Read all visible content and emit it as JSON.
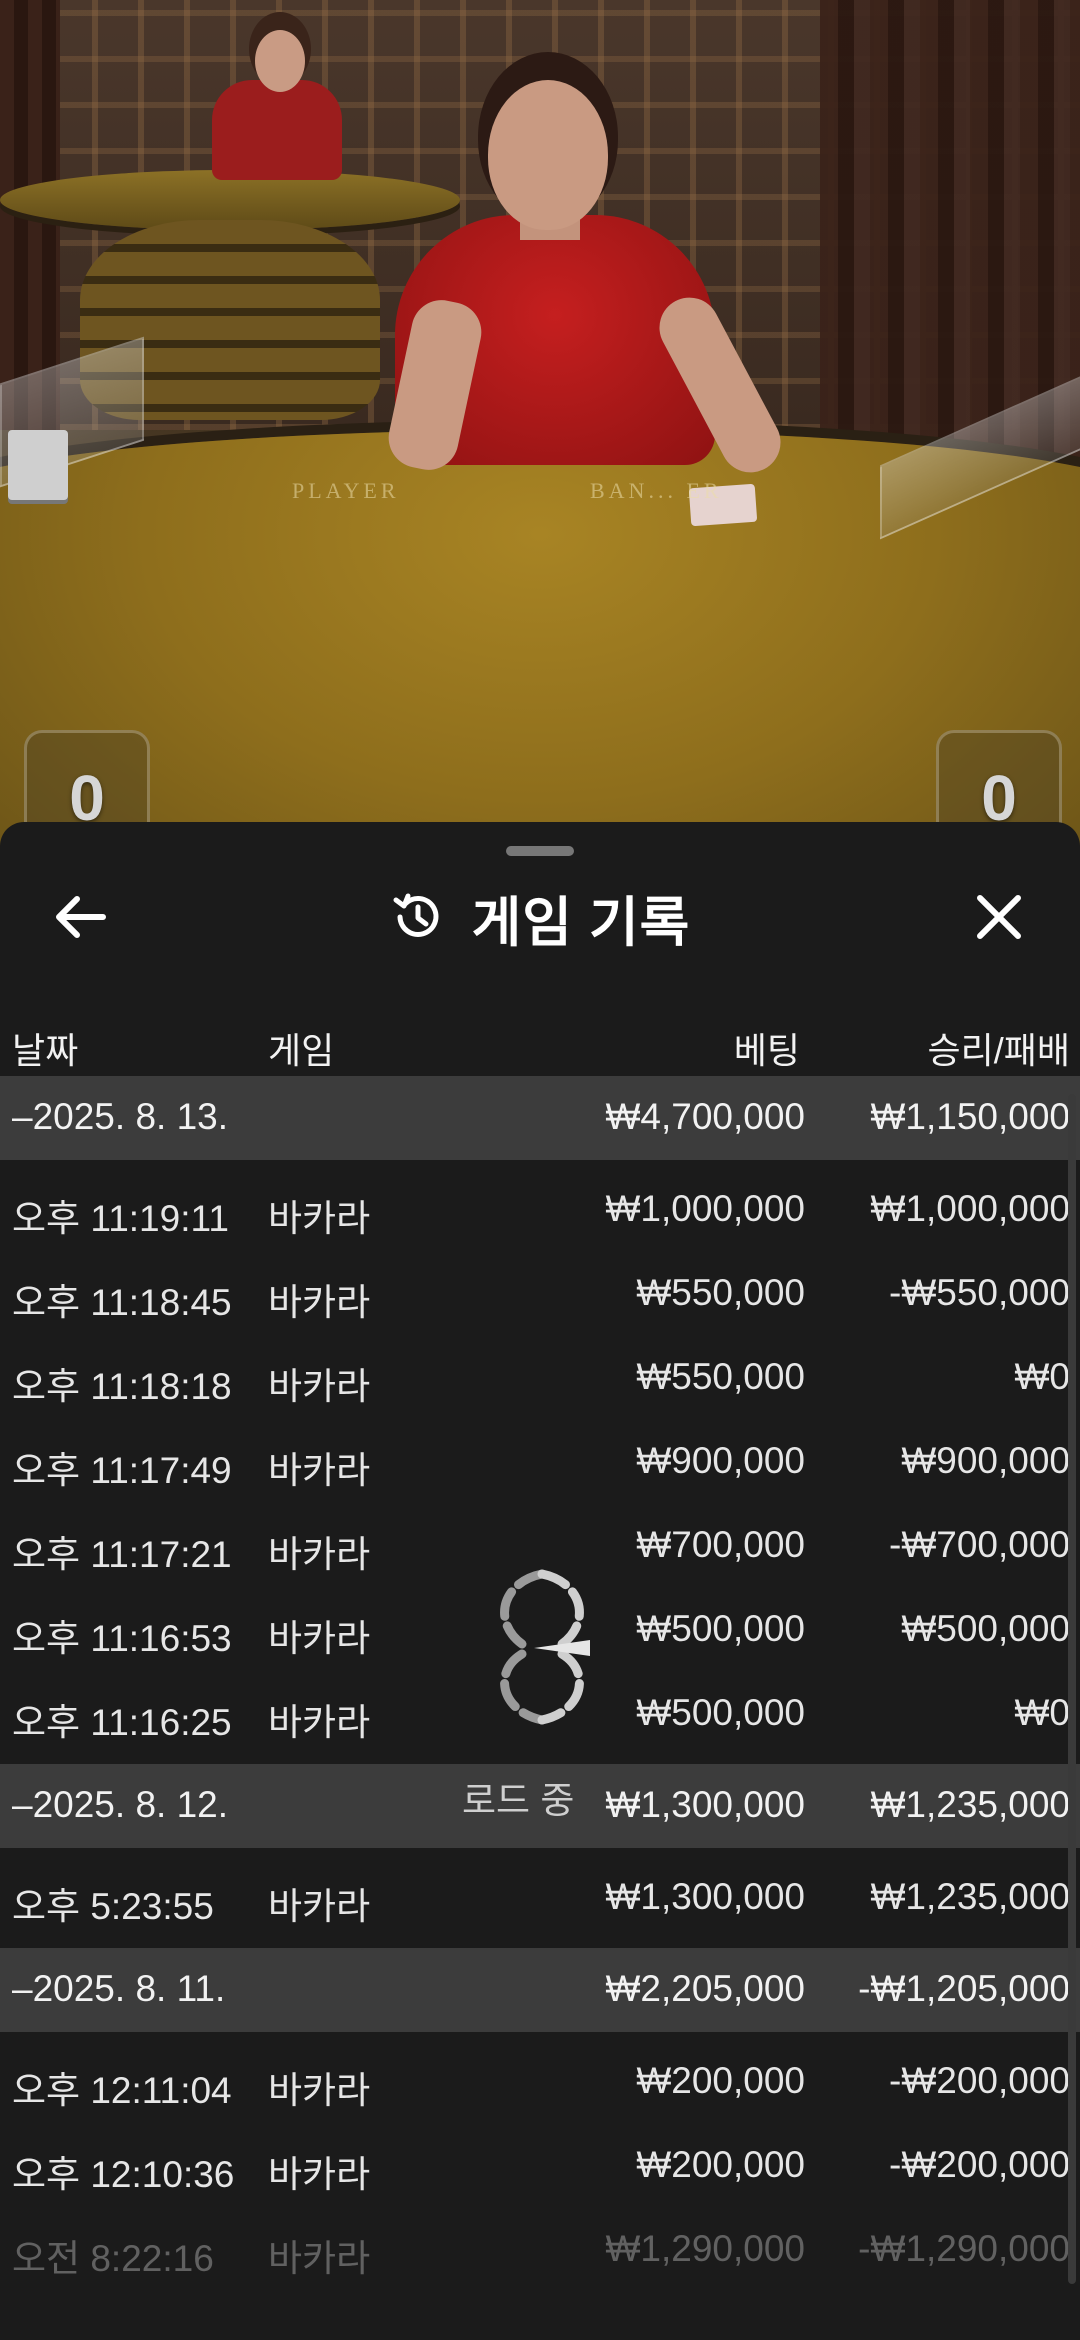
{
  "sheet": {
    "title": "게임 기록",
    "headers": {
      "date": "날짜",
      "game": "게임",
      "bet": "베팅",
      "win_loss": "승리/패배"
    },
    "loading_text": "로드 중"
  },
  "video": {
    "score_player": "0",
    "score_banker": "0",
    "table_labels": {
      "player": "PLAYER",
      "banker": "BAN... ER"
    }
  },
  "groups": [
    {
      "date": "–2025. 8. 13.",
      "bet": "₩4,700,000",
      "win": "₩1,150,000",
      "rows": [
        {
          "time": "오후 11:19:11",
          "game": "바카라",
          "bet": "₩1,000,000",
          "win": "₩1,000,000"
        },
        {
          "time": "오후 11:18:45",
          "game": "바카라",
          "bet": "₩550,000",
          "win": "-₩550,000"
        },
        {
          "time": "오후 11:18:18",
          "game": "바카라",
          "bet": "₩550,000",
          "win": "₩0"
        },
        {
          "time": "오후 11:17:49",
          "game": "바카라",
          "bet": "₩900,000",
          "win": "₩900,000"
        },
        {
          "time": "오후 11:17:21",
          "game": "바카라",
          "bet": "₩700,000",
          "win": "-₩700,000"
        },
        {
          "time": "오후 11:16:53",
          "game": "바카라",
          "bet": "₩500,000",
          "win": "₩500,000"
        },
        {
          "time": "오후 11:16:25",
          "game": "바카라",
          "bet": "₩500,000",
          "win": "₩0"
        }
      ]
    },
    {
      "date": "–2025. 8. 12.",
      "bet": "₩1,300,000",
      "win": "₩1,235,000",
      "rows": [
        {
          "time": "오후 5:23:55",
          "game": "바카라",
          "bet": "₩1,300,000",
          "win": "₩1,235,000"
        }
      ]
    },
    {
      "date": "–2025. 8. 11.",
      "bet": "₩2,205,000",
      "win": "-₩1,205,000",
      "rows": [
        {
          "time": "오후 12:11:04",
          "game": "바카라",
          "bet": "₩200,000",
          "win": "-₩200,000"
        },
        {
          "time": "오후 12:10:36",
          "game": "바카라",
          "bet": "₩200,000",
          "win": "-₩200,000"
        },
        {
          "time": "오전 8:22:16",
          "game": "바카라",
          "bet": "₩1,290,000",
          "win": "-₩1,290,000"
        }
      ]
    }
  ]
}
